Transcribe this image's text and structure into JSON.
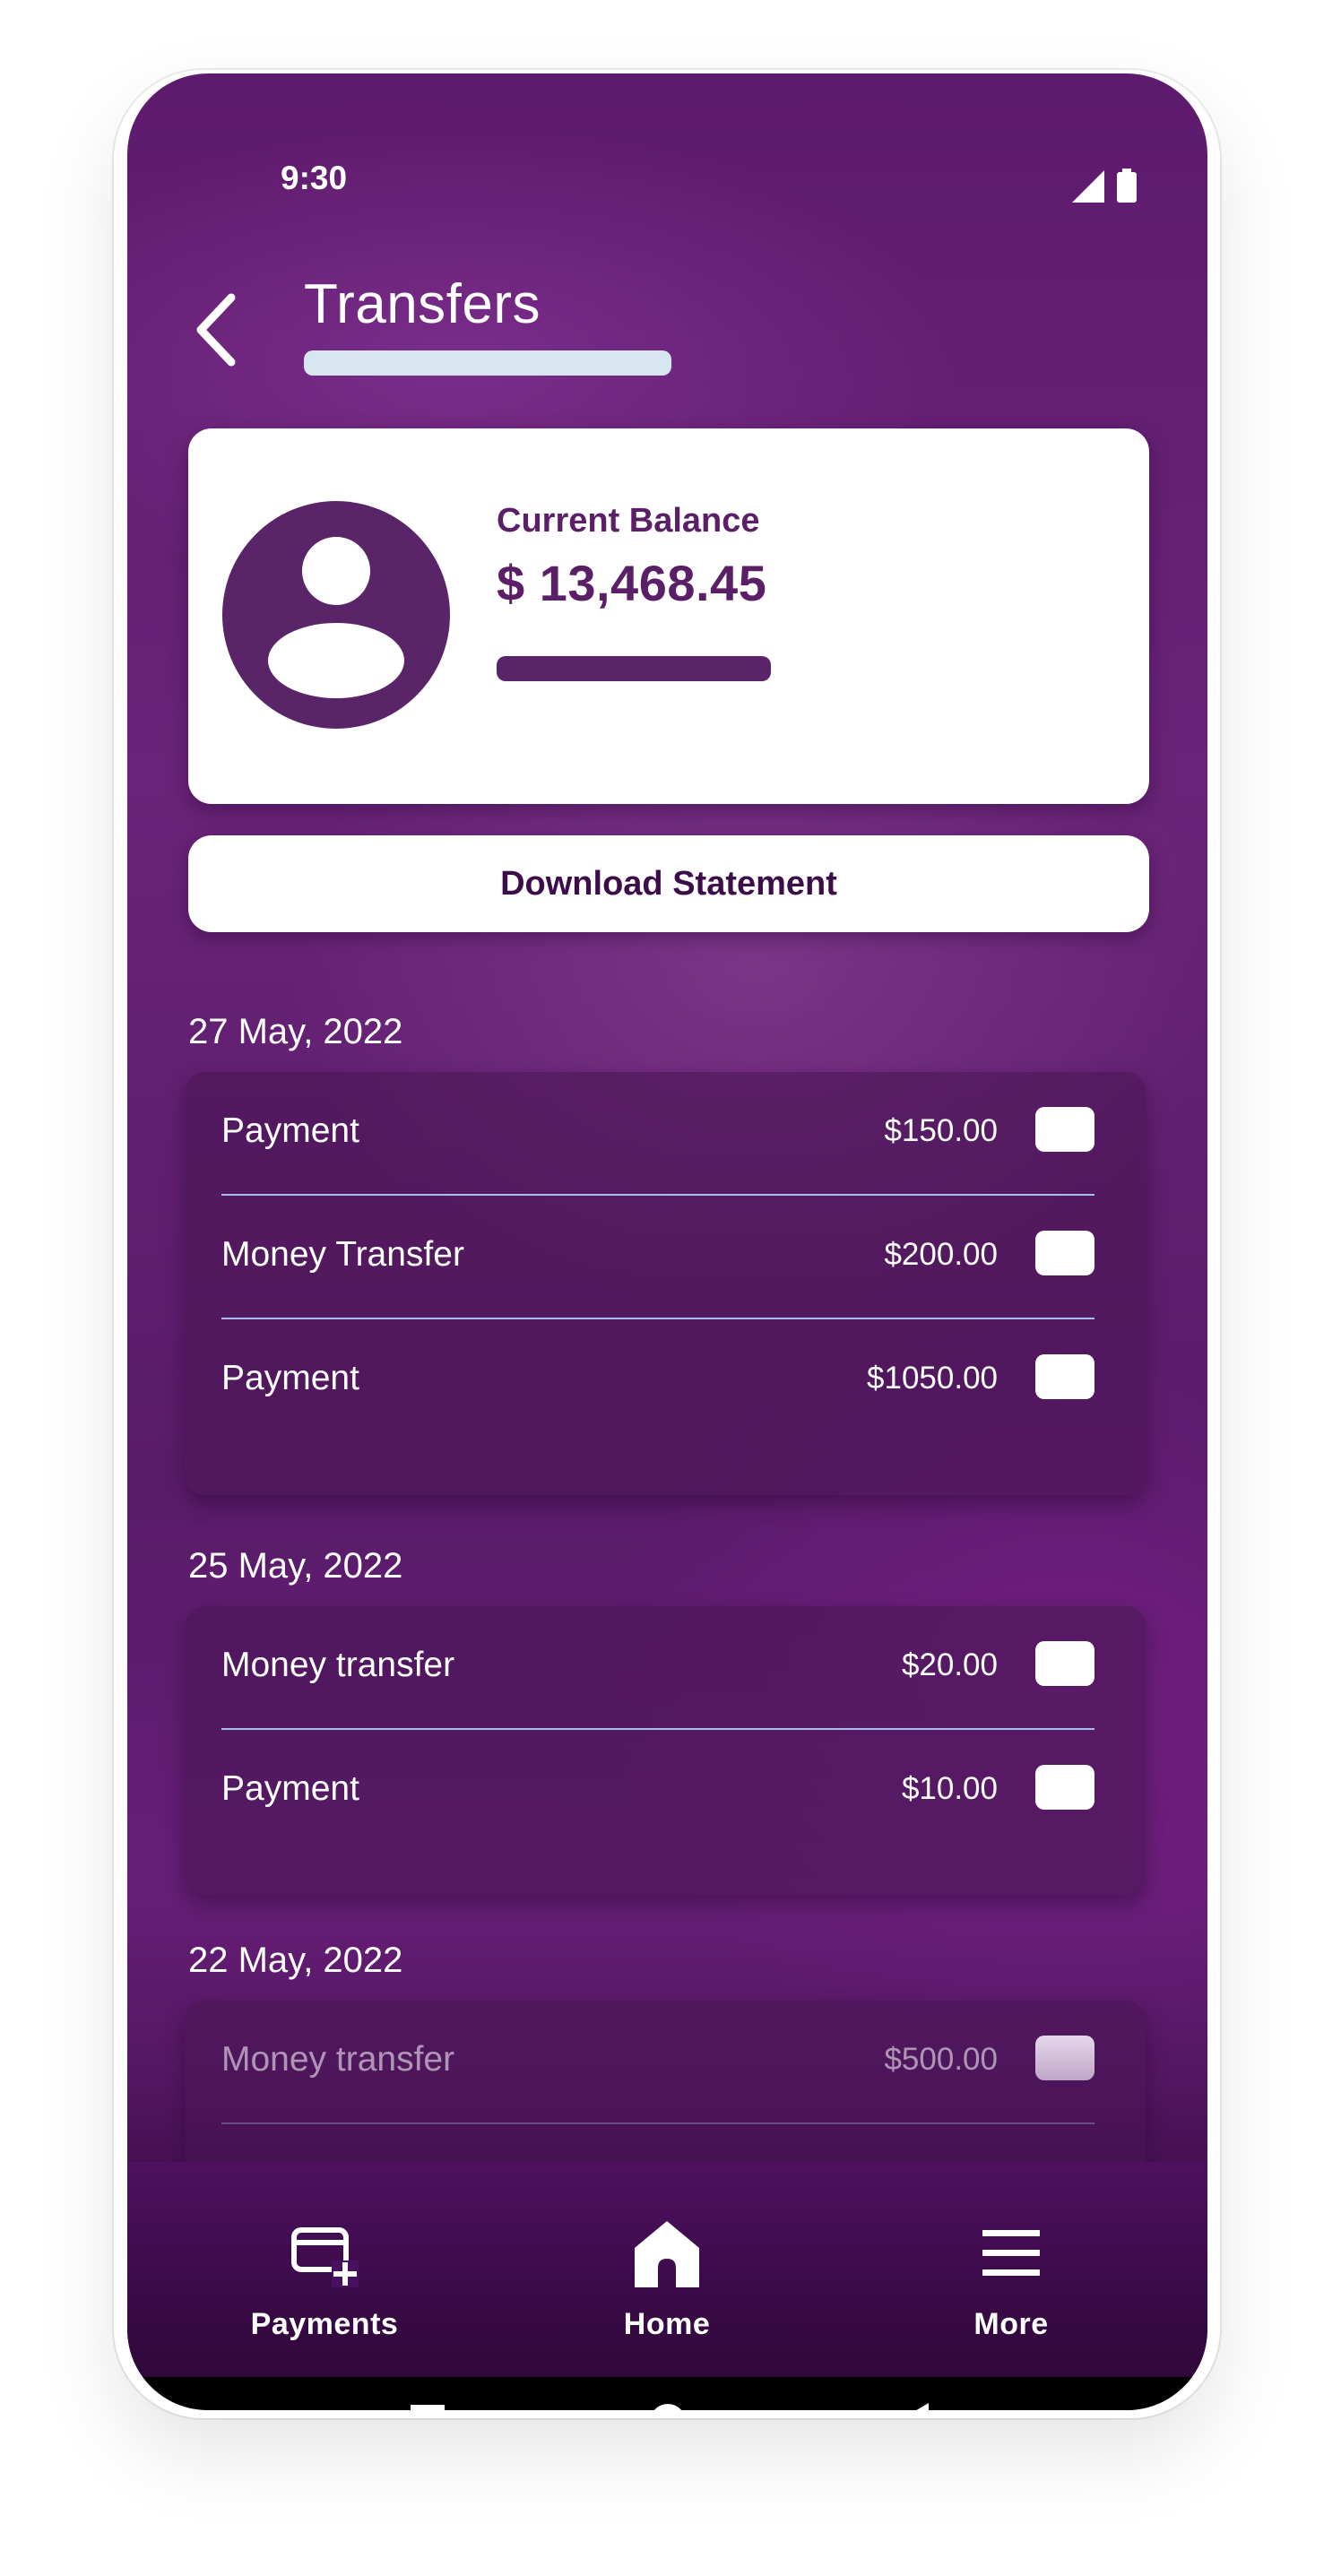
{
  "status_bar": {
    "time": "9:30",
    "icons": [
      "signal-icon",
      "battery-icon"
    ]
  },
  "header": {
    "title": "Transfers",
    "back_icon": "chevron-left-icon"
  },
  "balance": {
    "label": "Current Balance",
    "amount": "$ 13,468.45",
    "avatar_icon": "user-avatar-icon"
  },
  "download_button": {
    "label": "Download Statement"
  },
  "groups": [
    {
      "date": "27 May, 2022",
      "items": [
        {
          "label": "Payment",
          "amount": "$150.00"
        },
        {
          "label": "Money Transfer",
          "amount": "$200.00"
        },
        {
          "label": "Payment",
          "amount": "$1050.00"
        }
      ]
    },
    {
      "date": "25 May, 2022",
      "items": [
        {
          "label": "Money transfer",
          "amount": "$20.00"
        },
        {
          "label": "Payment",
          "amount": "$10.00"
        }
      ]
    },
    {
      "date": "22 May, 2022",
      "items": [
        {
          "label": "Money transfer",
          "amount": "$500.00"
        }
      ]
    }
  ],
  "bottom_nav": {
    "items": [
      {
        "label": "Payments",
        "icon": "card-add-icon"
      },
      {
        "label": "Home",
        "icon": "home-icon"
      },
      {
        "label": "More",
        "icon": "menu-icon"
      }
    ]
  },
  "system_nav": {
    "icons": [
      "square-recents-icon",
      "circle-home-icon",
      "triangle-back-icon"
    ]
  },
  "colors": {
    "background": "#5e1a6c",
    "accent": "#5a1f67",
    "card": "#ffffff",
    "divider": "#a6bff0",
    "title_underline": "#d8e6f2"
  }
}
